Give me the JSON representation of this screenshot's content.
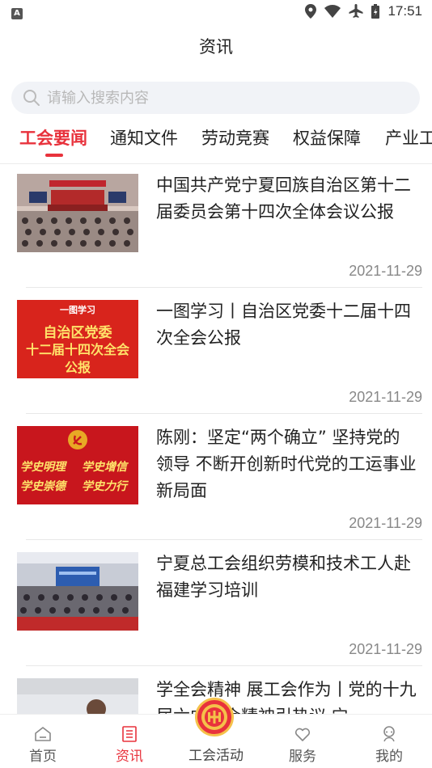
{
  "status_bar": {
    "left_badge": "A",
    "time": "17:51"
  },
  "page_title": "资讯",
  "search": {
    "placeholder": "请输入搜索内容"
  },
  "tabs": [
    {
      "label": "工会要闻",
      "active": true
    },
    {
      "label": "通知文件",
      "active": false
    },
    {
      "label": "劳动竞赛",
      "active": false
    },
    {
      "label": "权益保障",
      "active": false
    },
    {
      "label": "产业工",
      "active": false
    }
  ],
  "news": [
    {
      "title": "中国共产党宁夏回族自治区第十二届委员会第十四次全体会议公报",
      "date": "2021-11-29",
      "thumb": "conference-photo"
    },
    {
      "title": "一图学习丨自治区党委十二届十四次全会公报",
      "date": "2021-11-29",
      "thumb": "red-poster",
      "thumb_text": {
        "top": "一图学习",
        "line1": "自治区党委",
        "line2": "十二届十四次全会",
        "line3": "公报"
      }
    },
    {
      "title": "陈刚：坚定“两个确立” 坚持党的领导 不断开创新时代党的工运事业新局面",
      "date": "2021-11-29",
      "thumb": "party-banner",
      "thumb_text": {
        "a": "学史明理",
        "b": "学史增信",
        "c": "学史崇德",
        "d": "学史力行"
      }
    },
    {
      "title": "宁夏总工会组织劳模和技术工人赴福建学习培训",
      "date": "2021-11-29",
      "thumb": "training-photo"
    },
    {
      "title": "学全会精神 展工会作为丨党的十九届六中全会精神引热议 宁",
      "date": "",
      "thumb": "portrait-photo"
    }
  ],
  "bottom_nav": {
    "home": "首页",
    "news": "资讯",
    "union_activity": "工会活动",
    "service": "服务",
    "mine": "我的"
  },
  "colors": {
    "accent": "#e8323c",
    "gold": "#f5c14a"
  }
}
